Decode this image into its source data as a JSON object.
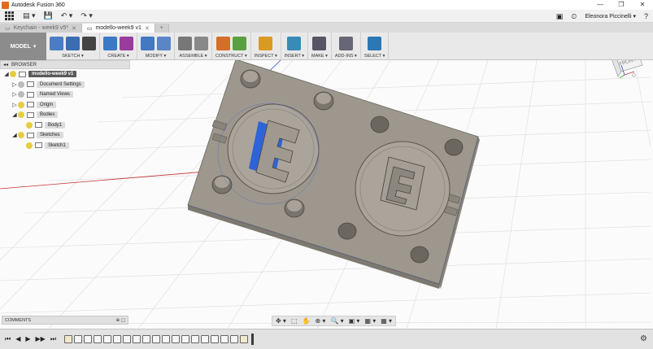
{
  "window": {
    "title": "Autodesk Fusion 360",
    "controls": {
      "minimize": "—",
      "maximize": "❐",
      "close": "✕"
    }
  },
  "qat": {
    "save": "💾",
    "undo": "↶ ▾",
    "redo": "↷ ▾",
    "user": "Eleonora Piccinelli ▾"
  },
  "tabs": [
    {
      "label": "Keychain - week9 v5*",
      "active": false
    },
    {
      "label": "modello-week9 v1",
      "active": true
    }
  ],
  "ribbon": {
    "workspace": "MODEL",
    "groups": [
      {
        "label": "SKETCH ▾",
        "colors": [
          "#4a7dc3",
          "#3a6db3",
          "#444"
        ]
      },
      {
        "label": "CREATE ▾",
        "colors": [
          "#3c79c7",
          "#9a3c9e"
        ]
      },
      {
        "label": "MODIFY ▾",
        "colors": [
          "#4279c0",
          "#5a86c8"
        ]
      },
      {
        "label": "ASSEMBLE ▾",
        "colors": [
          "#777",
          "#888"
        ]
      },
      {
        "label": "CONSTRUCT ▾",
        "colors": [
          "#d36f2a",
          "#5aa042"
        ]
      },
      {
        "label": "INSPECT ▾",
        "colors": [
          "#d99a24"
        ]
      },
      {
        "label": "INSERT ▾",
        "colors": [
          "#3a8ab8"
        ]
      },
      {
        "label": "MAKE ▾",
        "colors": [
          "#556"
        ]
      },
      {
        "label": "ADD-INS ▾",
        "colors": [
          "#667"
        ]
      },
      {
        "label": "SELECT ▾",
        "colors": [
          "#2a78b5"
        ]
      }
    ]
  },
  "browser": {
    "header": "BROWSER",
    "items": [
      {
        "label": "modello-week9 v1",
        "level": 0,
        "root": true
      },
      {
        "label": "Document Settings",
        "level": 1
      },
      {
        "label": "Named Views",
        "level": 1
      },
      {
        "label": "Origin",
        "level": 1
      },
      {
        "label": "Bodies",
        "level": 1
      },
      {
        "label": "Body1",
        "level": 2
      },
      {
        "label": "Sketches",
        "level": 1
      },
      {
        "label": "Sketch1",
        "level": 2
      }
    ]
  },
  "viewcube": {
    "face_label": "FRONT"
  },
  "comments": {
    "label": "COMMENTS"
  },
  "navbar": {
    "icons": [
      "✥ ▾",
      "⬚",
      "✋",
      "⊕ ▾",
      "🔍 ▾",
      "▣ ▾",
      "▦ ▾",
      "▦ ▾"
    ]
  },
  "timeline": {
    "controls": [
      "⏮",
      "◀",
      "▶",
      "▶▶",
      "⏭"
    ],
    "items": [
      "sketch",
      "feature",
      "feature",
      "feature",
      "feature",
      "feature",
      "feature",
      "feature",
      "feature",
      "feature",
      "feature",
      "feature",
      "feature",
      "feature",
      "feature",
      "feature",
      "feature",
      "feature",
      "sketch"
    ]
  },
  "colors": {
    "part_top": "#9a948b",
    "part_side": "#7e796f",
    "selection_blue": "#2f63d8",
    "grid": "#d7d7d7"
  }
}
